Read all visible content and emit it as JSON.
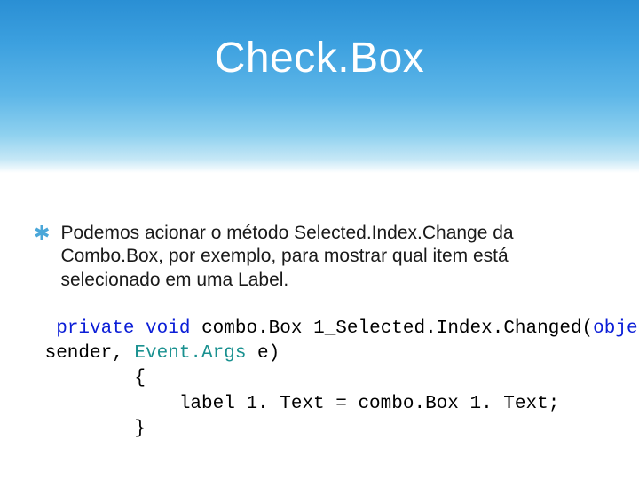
{
  "title": "Check.Box",
  "bullet": {
    "text": "Podemos acionar o método Selected.Index.Change da Combo.Box, por exemplo, para mostrar qual item está selecionado em uma Label."
  },
  "code": {
    "kw_private": "private",
    "kw_void": "void",
    "method": " combo.Box 1_Selected.Index.Changed(",
    "kw_object": "object",
    "after_object": " sender, ",
    "type_eventargs": "Event.Args",
    "after_eventargs": " e)",
    "brace_open": "         {",
    "body_line": "             label 1. Text = combo.Box 1. Text;",
    "brace_close": "         }"
  }
}
